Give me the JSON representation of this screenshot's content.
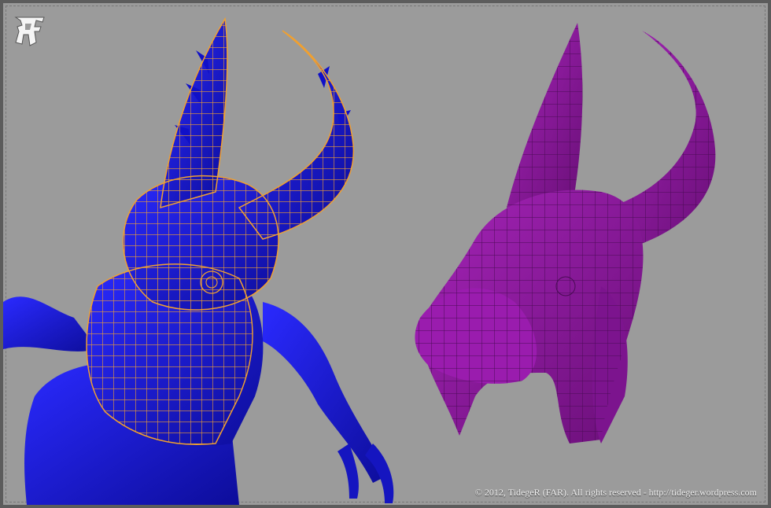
{
  "image": {
    "background_color": "#9b9b9b",
    "subjects": [
      {
        "name": "demon-sculpt-with-wireframe",
        "color": "#1a1ad6",
        "wire_color": "#f0a030"
      },
      {
        "name": "demon-head-retopology",
        "color": "#8c1a9c"
      }
    ]
  },
  "logo": {
    "text": "FAR"
  },
  "copyright": "© 2012, TidegeR (FAR). All rights reserved - http://tideger.wordpress.com"
}
